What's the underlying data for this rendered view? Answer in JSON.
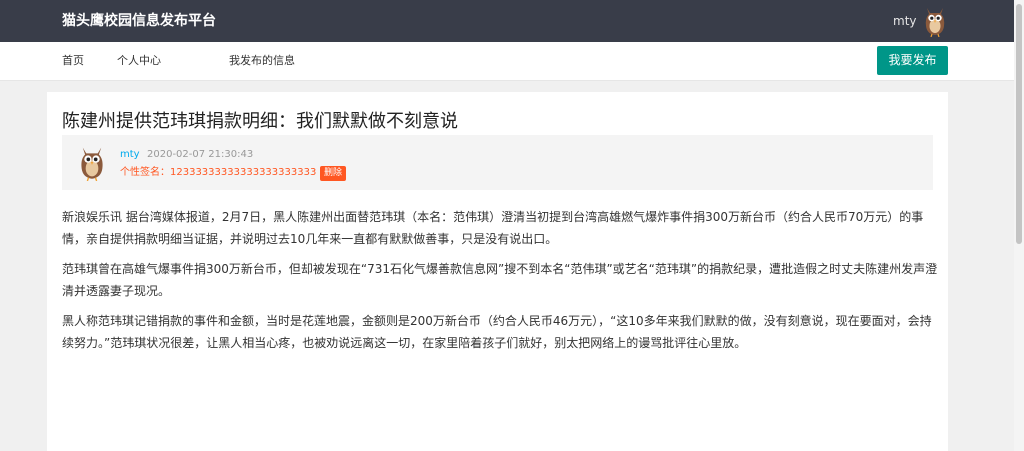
{
  "header": {
    "brand": "猫头鹰校园信息发布平台",
    "username": "mty",
    "avatar_icon": "owl-icon"
  },
  "nav": {
    "items": [
      {
        "label": "首页"
      },
      {
        "label": "个人中心"
      },
      {
        "label": "我发布的信息"
      }
    ],
    "publish_label": "我要发布"
  },
  "article": {
    "title": "陈建州提供范玮琪捐款明细：我们默默做不刻意说",
    "author": "mty",
    "time": "2020-02-07 21:30:43",
    "signature": "个性签名：12333333333333333333333",
    "delete_label": "删除",
    "paragraphs": [
      "新浪娱乐讯 据台湾媒体报道，2月7日，黑人陈建州出面替范玮琪（本名：范伟琪）澄清当初提到台湾高雄燃气爆炸事件捐300万新台币（约合人民币70万元）的事情，亲自提供捐款明细当证据，并说明过去10几年来一直都有默默做善事，只是没有说出口。",
      "范玮琪曾在高雄气爆事件捐300万新台币，但却被发现在“731石化气爆善款信息网”搜不到本名“范伟琪”或艺名“范玮琪”的捐款纪录，遭批造假之时丈夫陈建州发声澄清并透露妻子现况。",
      "黑人称范玮琪记错捐款的事件和金额，当时是花莲地震，金额则是200万新台币（约合人民币46万元），“这10多年来我们默默的做，没有刻意说，现在要面对，会持续努力。”范玮琪状况很差，让黑人相当心疼，也被劝说远离这一切，在家里陪着孩子们就好，别太把网络上的谩骂批评往心里放。"
    ]
  },
  "colors": {
    "topbar": "#393d49",
    "accent": "#009688",
    "danger": "#ff5722",
    "link": "#01aaed"
  }
}
